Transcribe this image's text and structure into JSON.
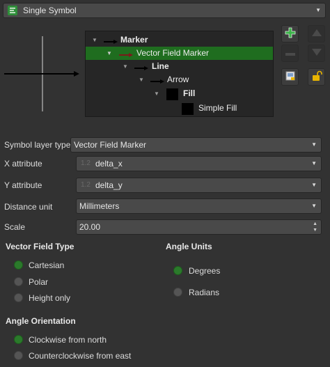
{
  "colors": {
    "background": "#323232",
    "selection": "#1f6d1f",
    "radio_on": "#2b7a2b",
    "vector_arrow": "#7a1a1a",
    "add_icon": "#3cb44a",
    "lock_icon": "#e8b400"
  },
  "symbol_type_select": {
    "value": "Single Symbol",
    "icon": "single-symbol-icon",
    "arrow": "▼"
  },
  "layer_tree": {
    "rows": [
      {
        "label": "Marker",
        "bold": true
      },
      {
        "label": "Vector Field Marker",
        "bold": false,
        "selected": true
      },
      {
        "label": "Line",
        "bold": true
      },
      {
        "label": "Arrow",
        "bold": false
      },
      {
        "label": "Fill",
        "bold": true
      },
      {
        "label": "Simple Fill",
        "bold": false
      }
    ]
  },
  "side_buttons": {
    "add": "add-layer-icon",
    "remove": "remove-layer-icon",
    "duplicate": "duplicate-layer-icon",
    "move_up": "move-up-icon",
    "move_down": "move-down-icon",
    "lock": "lock-icon"
  },
  "form": {
    "symbol_layer_type": {
      "label": "Symbol layer type",
      "value": "Vector Field Marker"
    },
    "x_attribute": {
      "label": "X attribute",
      "value": "delta_x",
      "icon": "1.2"
    },
    "y_attribute": {
      "label": "Y attribute",
      "value": "delta_y",
      "icon": "1.2"
    },
    "distance_unit": {
      "label": "Distance unit",
      "value": "Millimeters"
    },
    "scale": {
      "label": "Scale",
      "value": "20.00"
    }
  },
  "vector_field_type": {
    "title": "Vector Field Type",
    "options": [
      {
        "label": "Cartesian",
        "checked": true
      },
      {
        "label": "Polar",
        "checked": false
      },
      {
        "label": "Height only",
        "checked": false
      }
    ]
  },
  "angle_units": {
    "title": "Angle Units",
    "options": [
      {
        "label": "Degrees",
        "checked": true
      },
      {
        "label": "Radians",
        "checked": false
      }
    ]
  },
  "angle_orientation": {
    "title": "Angle Orientation",
    "options": [
      {
        "label": "Clockwise from north",
        "checked": true
      },
      {
        "label": "Counterclockwise from east",
        "checked": false
      }
    ]
  }
}
